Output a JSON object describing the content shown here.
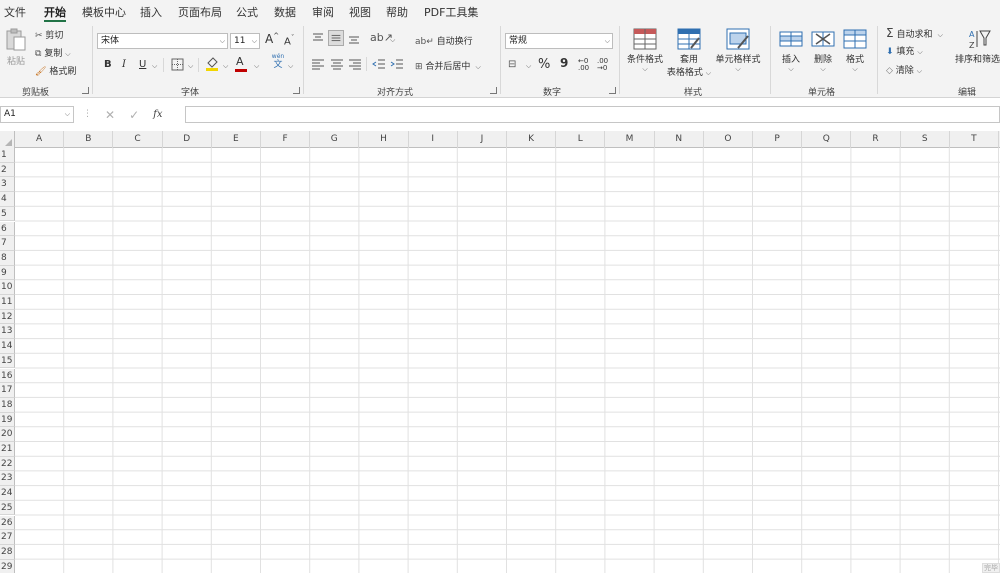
{
  "menu": {
    "tabs": [
      {
        "label": "文件"
      },
      {
        "label": "开始",
        "active": true
      },
      {
        "label": "模板中心"
      },
      {
        "label": "插入"
      },
      {
        "label": "页面布局"
      },
      {
        "label": "公式"
      },
      {
        "label": "数据"
      },
      {
        "label": "审阅"
      },
      {
        "label": "视图"
      },
      {
        "label": "帮助"
      },
      {
        "label": "PDF工具集"
      }
    ]
  },
  "ribbon": {
    "clipboard": {
      "paste": "粘贴",
      "cut": "剪切",
      "copy": "复制",
      "format_painter": "格式刷",
      "group": "剪贴板"
    },
    "font": {
      "family": "宋体",
      "size": "11",
      "bold": "B",
      "italic": "I",
      "underline": "U",
      "font_color_letter": "A",
      "phonetic": "文",
      "phonetic_top": "wén",
      "grow": "A",
      "shrink": "A",
      "group": "字体",
      "highlight_color": "#f2d600",
      "font_color": "#c00000"
    },
    "alignment": {
      "wrap_text": "自动换行",
      "merge_center": "合并后居中",
      "group": "对齐方式"
    },
    "number": {
      "format": "常规",
      "percent": "%",
      "comma": "9",
      "inc_decimal": "←0 .00",
      "dec_decimal": ".00 →0",
      "group": "数字"
    },
    "styles": {
      "conditional": "条件格式",
      "table_format_1": "套用",
      "table_format_2": "表格格式",
      "cell_styles": "单元格样式",
      "group": "样式"
    },
    "cells": {
      "insert": "插入",
      "delete": "删除",
      "format": "格式",
      "group": "单元格"
    },
    "editing": {
      "autosum": "自动求和",
      "fill": "填充",
      "clear": "清除",
      "sort_filter": "排序和筛选",
      "group": "编辑"
    }
  },
  "formula_bar": {
    "name_box": "A1",
    "fx": "fx",
    "formula": ""
  },
  "sheet": {
    "columns": [
      "A",
      "B",
      "C",
      "D",
      "E",
      "F",
      "G",
      "H",
      "I",
      "J",
      "K",
      "L",
      "M",
      "N",
      "O",
      "P",
      "Q",
      "R",
      "S",
      "T"
    ],
    "rows": [
      "1",
      "2",
      "3",
      "4",
      "5",
      "6",
      "7",
      "8",
      "9",
      "10",
      "11",
      "12",
      "13",
      "14",
      "15",
      "16",
      "17",
      "18",
      "19",
      "20",
      "21",
      "22",
      "23",
      "24",
      "25",
      "26",
      "27",
      "28",
      "29"
    ],
    "corner_tag": "完毕"
  }
}
